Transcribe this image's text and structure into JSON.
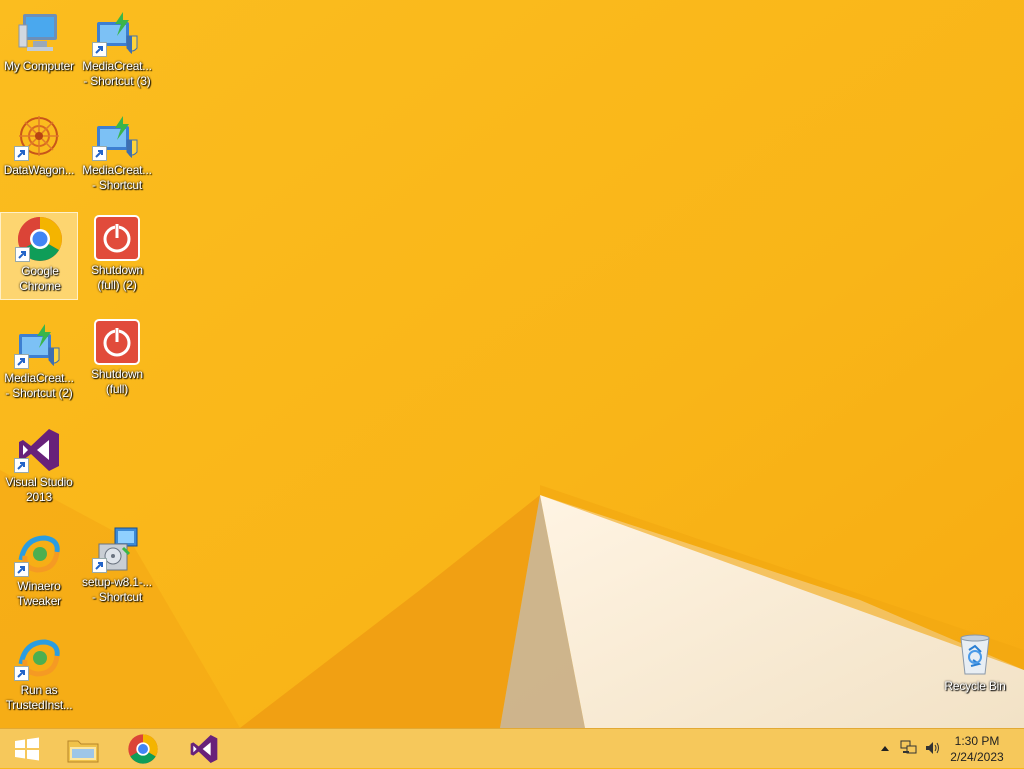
{
  "desktop_icons": [
    {
      "label": "My Computer",
      "icon": "computer-icon"
    },
    {
      "label": "MediaCreat...\n- Shortcut (3)",
      "icon": "media-creation-tool-icon"
    },
    {
      "label": "DataWagon...",
      "icon": "datawagon-icon"
    },
    {
      "label": "MediaCreat...\n- Shortcut",
      "icon": "media-creation-tool-icon"
    },
    {
      "label": "Google\nChrome",
      "icon": "chrome-icon",
      "selected": true
    },
    {
      "label": "Shutdown\n(full) (2)",
      "icon": "shutdown-icon"
    },
    {
      "label": "MediaCreat...\n- Shortcut (2)",
      "icon": "media-creation-tool-icon"
    },
    {
      "label": "Shutdown\n(full)",
      "icon": "shutdown-icon"
    },
    {
      "label": "Visual Studio\n2013",
      "icon": "visual-studio-icon"
    },
    {
      "label": "Winaero\nTweaker",
      "icon": "winaero-tweaker-icon"
    },
    {
      "label": "setup-w8.1-...\n- Shortcut",
      "icon": "setup-installer-icon"
    },
    {
      "label": "Run as\nTrustedInst...",
      "icon": "winaero-tweaker-icon"
    },
    {
      "label": "Recycle Bin",
      "icon": "recycle-bin-icon"
    }
  ],
  "taskbar": {
    "pinned": [
      {
        "name": "start-button",
        "icon": "windows-logo-icon"
      },
      {
        "name": "file-explorer",
        "icon": "folder-icon"
      },
      {
        "name": "google-chrome",
        "icon": "chrome-icon"
      },
      {
        "name": "visual-studio",
        "icon": "visual-studio-icon"
      }
    ],
    "tray": {
      "icons": [
        "show-hidden-icons-arrow",
        "network-icon",
        "volume-icon"
      ],
      "time": "1:30 PM",
      "date": "2/24/2023"
    }
  },
  "colors": {
    "wallpaper": "#f9b71b",
    "taskbar": "#f6c85b",
    "accent_purple": "#68217a"
  }
}
